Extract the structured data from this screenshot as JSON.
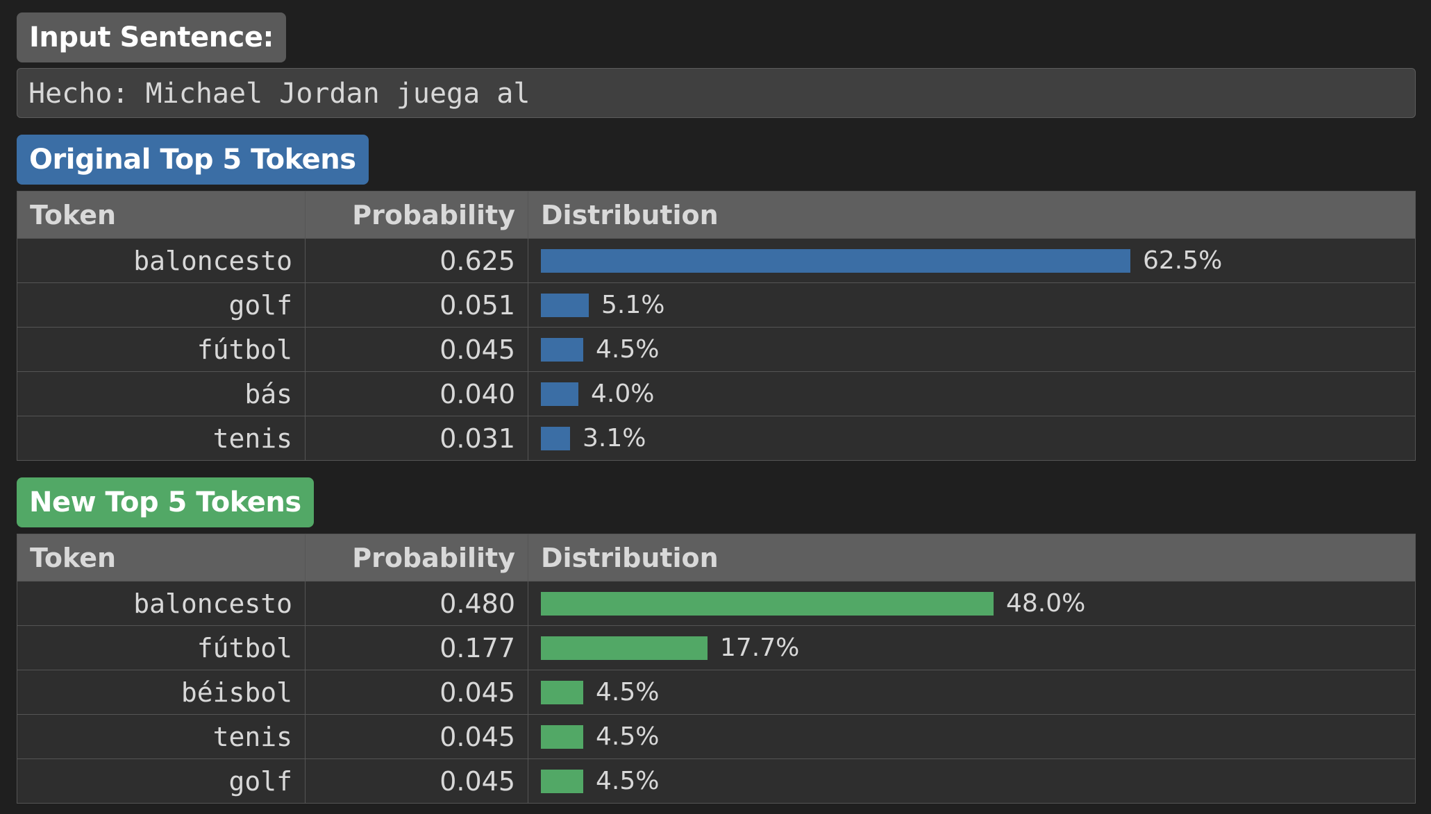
{
  "input": {
    "label": "Input Sentence:",
    "sentence": "Hecho: Michael Jordan juega al"
  },
  "headers": {
    "token": "Token",
    "probability": "Probability",
    "distribution": "Distribution"
  },
  "original": {
    "title": "Original Top 5 Tokens",
    "bar_color": "#3b6ea5",
    "rows": [
      {
        "token": "baloncesto",
        "probability": "0.625",
        "percent": "62.5%",
        "value": 0.625
      },
      {
        "token": "golf",
        "probability": "0.051",
        "percent": "5.1%",
        "value": 0.051
      },
      {
        "token": "fútbol",
        "probability": "0.045",
        "percent": "4.5%",
        "value": 0.045
      },
      {
        "token": "bás",
        "probability": "0.040",
        "percent": "4.0%",
        "value": 0.04
      },
      {
        "token": "tenis",
        "probability": "0.031",
        "percent": "3.1%",
        "value": 0.031
      }
    ]
  },
  "new": {
    "title": "New Top 5 Tokens",
    "bar_color": "#52a866",
    "rows": [
      {
        "token": "baloncesto",
        "probability": "0.480",
        "percent": "48.0%",
        "value": 0.48
      },
      {
        "token": "fútbol",
        "probability": "0.177",
        "percent": "17.7%",
        "value": 0.177
      },
      {
        "token": "béisbol",
        "probability": "0.045",
        "percent": "4.5%",
        "value": 0.045
      },
      {
        "token": "tenis",
        "probability": "0.045",
        "percent": "4.5%",
        "value": 0.045
      },
      {
        "token": "golf",
        "probability": "0.045",
        "percent": "4.5%",
        "value": 0.045
      }
    ]
  }
}
